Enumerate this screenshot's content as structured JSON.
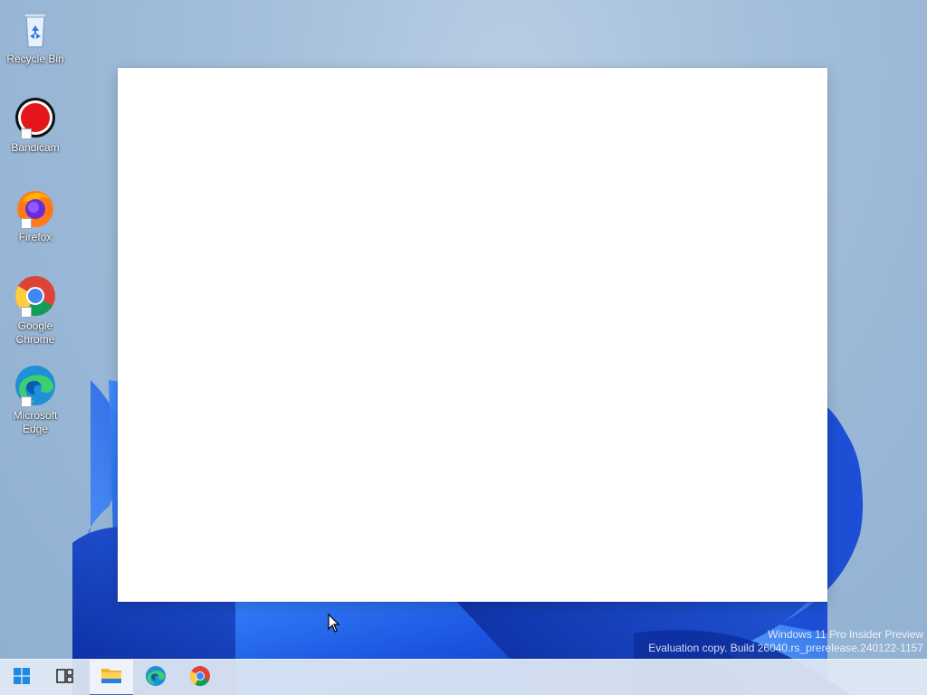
{
  "desktop": {
    "icons": [
      {
        "label": "Recycle Bin",
        "icon": "recycle-bin-icon"
      },
      {
        "label": "Bandicam",
        "icon": "bandicam-icon"
      },
      {
        "label": "Firefox",
        "icon": "firefox-icon"
      },
      {
        "label": "Google Chrome",
        "icon": "chrome-icon"
      },
      {
        "label": "Microsoft Edge",
        "icon": "edge-icon"
      }
    ]
  },
  "watermark": {
    "line1": "Windows 11 Pro Insider Preview",
    "line2": "Evaluation copy. Build 26040.rs_prerelease.240122-1157"
  },
  "taskbar": {
    "buttons": [
      {
        "icon": "windows-start-icon"
      },
      {
        "icon": "task-view-icon"
      },
      {
        "icon": "file-explorer-icon"
      },
      {
        "icon": "edge-icon"
      },
      {
        "icon": "chrome-icon"
      }
    ]
  },
  "colors": {
    "accent": "#2f6fcf",
    "window": "#ffffff"
  }
}
